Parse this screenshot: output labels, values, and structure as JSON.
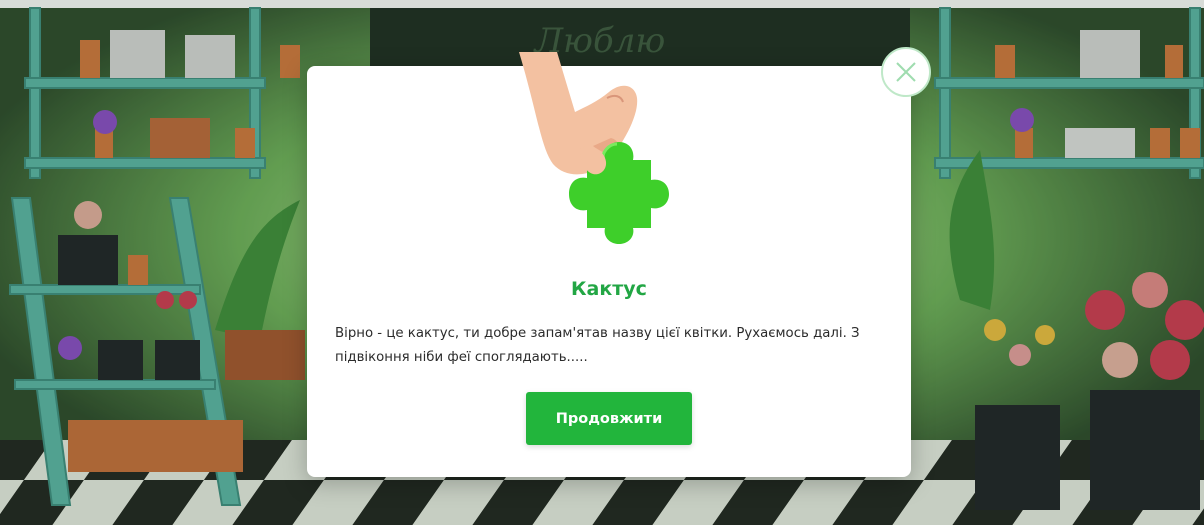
{
  "game": {
    "background_sign": "Люблю",
    "colors": {
      "accent": "#22b53c",
      "title": "#22a644",
      "close_border": "#bfe8c8"
    }
  },
  "modal": {
    "hero_icon": "hand-holding-puzzle-piece-icon",
    "title": "Кактус",
    "message": "Вірно - це кактус, ти добре запам'ятав назву цієї квітки. Рухаємось далі. З підвіконня ніби феї споглядають.....",
    "continue_label": "Продовжити",
    "close_icon": "close-icon"
  }
}
